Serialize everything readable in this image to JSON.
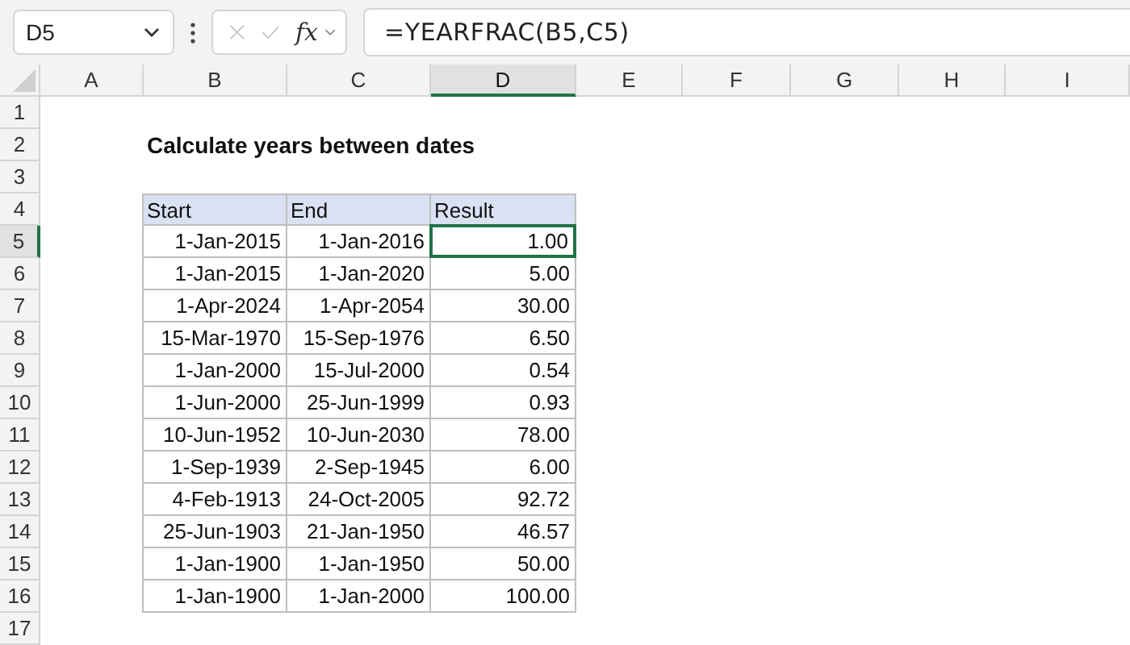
{
  "name_box": "D5",
  "function_button": "fx",
  "formula": "=YEARFRAC(B5,C5)",
  "columns": [
    {
      "label": "A",
      "selected": false
    },
    {
      "label": "B",
      "selected": false
    },
    {
      "label": "C",
      "selected": false
    },
    {
      "label": "D",
      "selected": true
    },
    {
      "label": "E",
      "selected": false
    },
    {
      "label": "F",
      "selected": false
    },
    {
      "label": "G",
      "selected": false
    },
    {
      "label": "H",
      "selected": false
    },
    {
      "label": "I",
      "selected": false
    }
  ],
  "rows": [
    {
      "label": "1",
      "selected": false
    },
    {
      "label": "2",
      "selected": false
    },
    {
      "label": "3",
      "selected": false
    },
    {
      "label": "4",
      "selected": false
    },
    {
      "label": "5",
      "selected": true
    },
    {
      "label": "6",
      "selected": false
    },
    {
      "label": "7",
      "selected": false
    },
    {
      "label": "8",
      "selected": false
    },
    {
      "label": "9",
      "selected": false
    },
    {
      "label": "10",
      "selected": false
    },
    {
      "label": "11",
      "selected": false
    },
    {
      "label": "12",
      "selected": false
    },
    {
      "label": "13",
      "selected": false
    },
    {
      "label": "14",
      "selected": false
    },
    {
      "label": "15",
      "selected": false
    },
    {
      "label": "16",
      "selected": false
    },
    {
      "label": "17",
      "selected": false
    }
  ],
  "title": "Calculate years between dates",
  "table": {
    "columns": [
      "Start",
      "End",
      "Result"
    ],
    "rows": [
      {
        "start": "1-Jan-2015",
        "end": "1-Jan-2016",
        "result": "1.00",
        "selected": true
      },
      {
        "start": "1-Jan-2015",
        "end": "1-Jan-2020",
        "result": "5.00",
        "selected": false
      },
      {
        "start": "1-Apr-2024",
        "end": "1-Apr-2054",
        "result": "30.00",
        "selected": false
      },
      {
        "start": "15-Mar-1970",
        "end": "15-Sep-1976",
        "result": "6.50",
        "selected": false
      },
      {
        "start": "1-Jan-2000",
        "end": "15-Jul-2000",
        "result": "0.54",
        "selected": false
      },
      {
        "start": "1-Jun-2000",
        "end": "25-Jun-1999",
        "result": "0.93",
        "selected": false
      },
      {
        "start": "10-Jun-1952",
        "end": "10-Jun-2030",
        "result": "78.00",
        "selected": false
      },
      {
        "start": "1-Sep-1939",
        "end": "2-Sep-1945",
        "result": "6.00",
        "selected": false
      },
      {
        "start": "4-Feb-1913",
        "end": "24-Oct-2005",
        "result": "92.72",
        "selected": false
      },
      {
        "start": "25-Jun-1903",
        "end": "21-Jan-1950",
        "result": "46.57",
        "selected": false
      },
      {
        "start": "1-Jan-1900",
        "end": "1-Jan-1950",
        "result": "50.00",
        "selected": false
      },
      {
        "start": "1-Jan-1900",
        "end": "1-Jan-2000",
        "result": "100.00",
        "selected": false
      }
    ]
  }
}
